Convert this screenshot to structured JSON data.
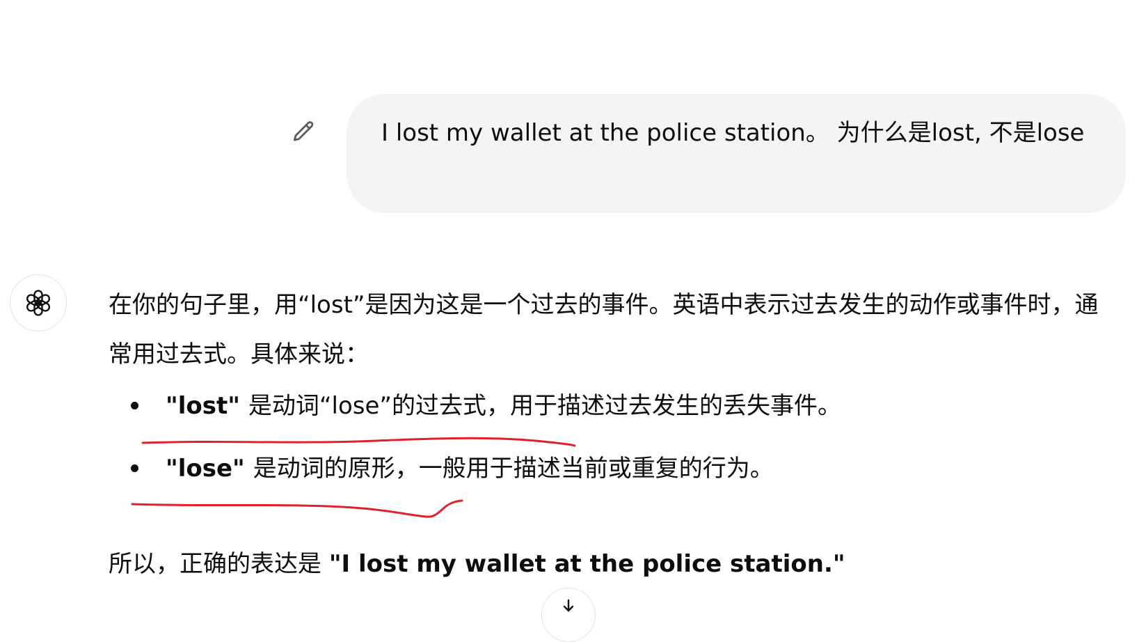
{
  "user_message": {
    "text": "I lost my wallet at the police station。 为什么是lost, 不是lose",
    "edit_icon": "pencil-icon"
  },
  "assistant": {
    "avatar_icon": "openai-logo-icon",
    "intro": "在你的句子里，用“lost”是因为这是一个过去的事件。英语中表示过去发生的动作或事件时，通常用过去式。具体来说：",
    "bullets": [
      {
        "term": "\"lost\"",
        "text": "是动词“lose”的过去式，用于描述过去发生的丢失事件。"
      },
      {
        "term": "\"lose\"",
        "text": "是动词的原形，一般用于描述当前或重复的行为。"
      }
    ],
    "conclusion_prefix": "所以，正确的表达是 ",
    "conclusion_quote": "\"I lost my wallet at the police station.\""
  },
  "scroll_button_icon": "arrow-down-icon",
  "colors": {
    "bubble_bg": "#f4f4f4",
    "text": "#0d0d0d",
    "annotation": "#e0202a"
  }
}
